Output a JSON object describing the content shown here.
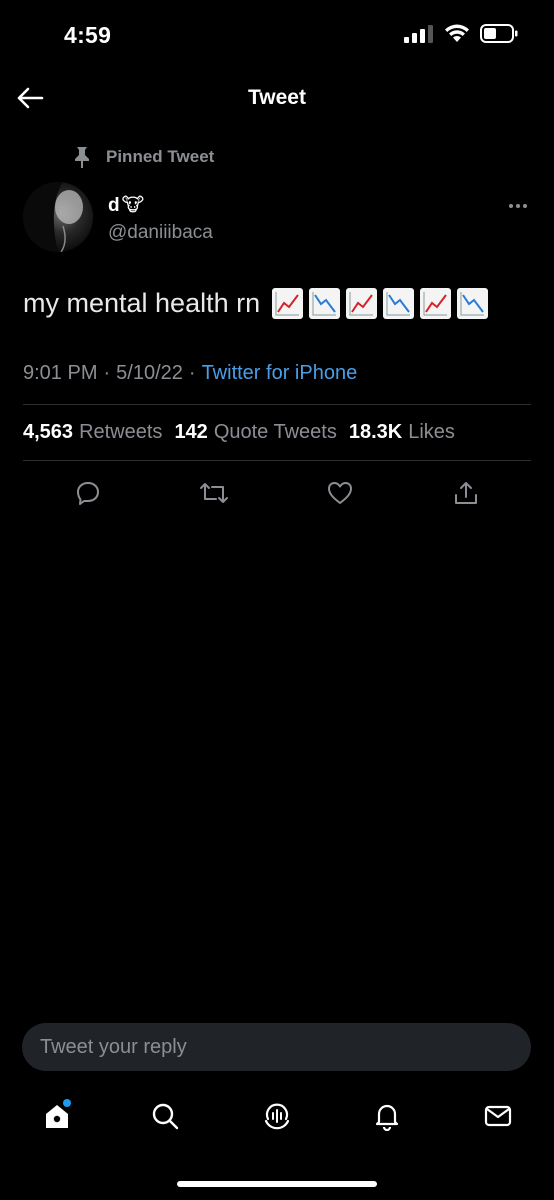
{
  "status_bar": {
    "time": "4:59"
  },
  "header": {
    "title": "Tweet"
  },
  "pinned": {
    "label": "Pinned Tweet"
  },
  "tweet": {
    "display_name": "d",
    "display_name_emoji": "🐮",
    "handle": "@daniiibaca",
    "text": "my mental health rn",
    "chart_emojis": [
      "chart-increasing",
      "chart-decreasing",
      "chart-increasing",
      "chart-decreasing",
      "chart-increasing",
      "chart-decreasing"
    ],
    "time": "9:01 PM",
    "separator": "·",
    "date": "5/10/22",
    "source": "Twitter for iPhone"
  },
  "stats": {
    "retweets_count": "4,563",
    "retweets_label": "Retweets",
    "quotes_count": "142",
    "quotes_label": "Quote Tweets",
    "likes_count": "18.3K",
    "likes_label": "Likes"
  },
  "reply": {
    "placeholder": "Tweet your reply"
  },
  "colors": {
    "accent": "#1d9bf0",
    "link": "#4a9ee8",
    "muted": "#8b8f94",
    "background": "#000000"
  }
}
